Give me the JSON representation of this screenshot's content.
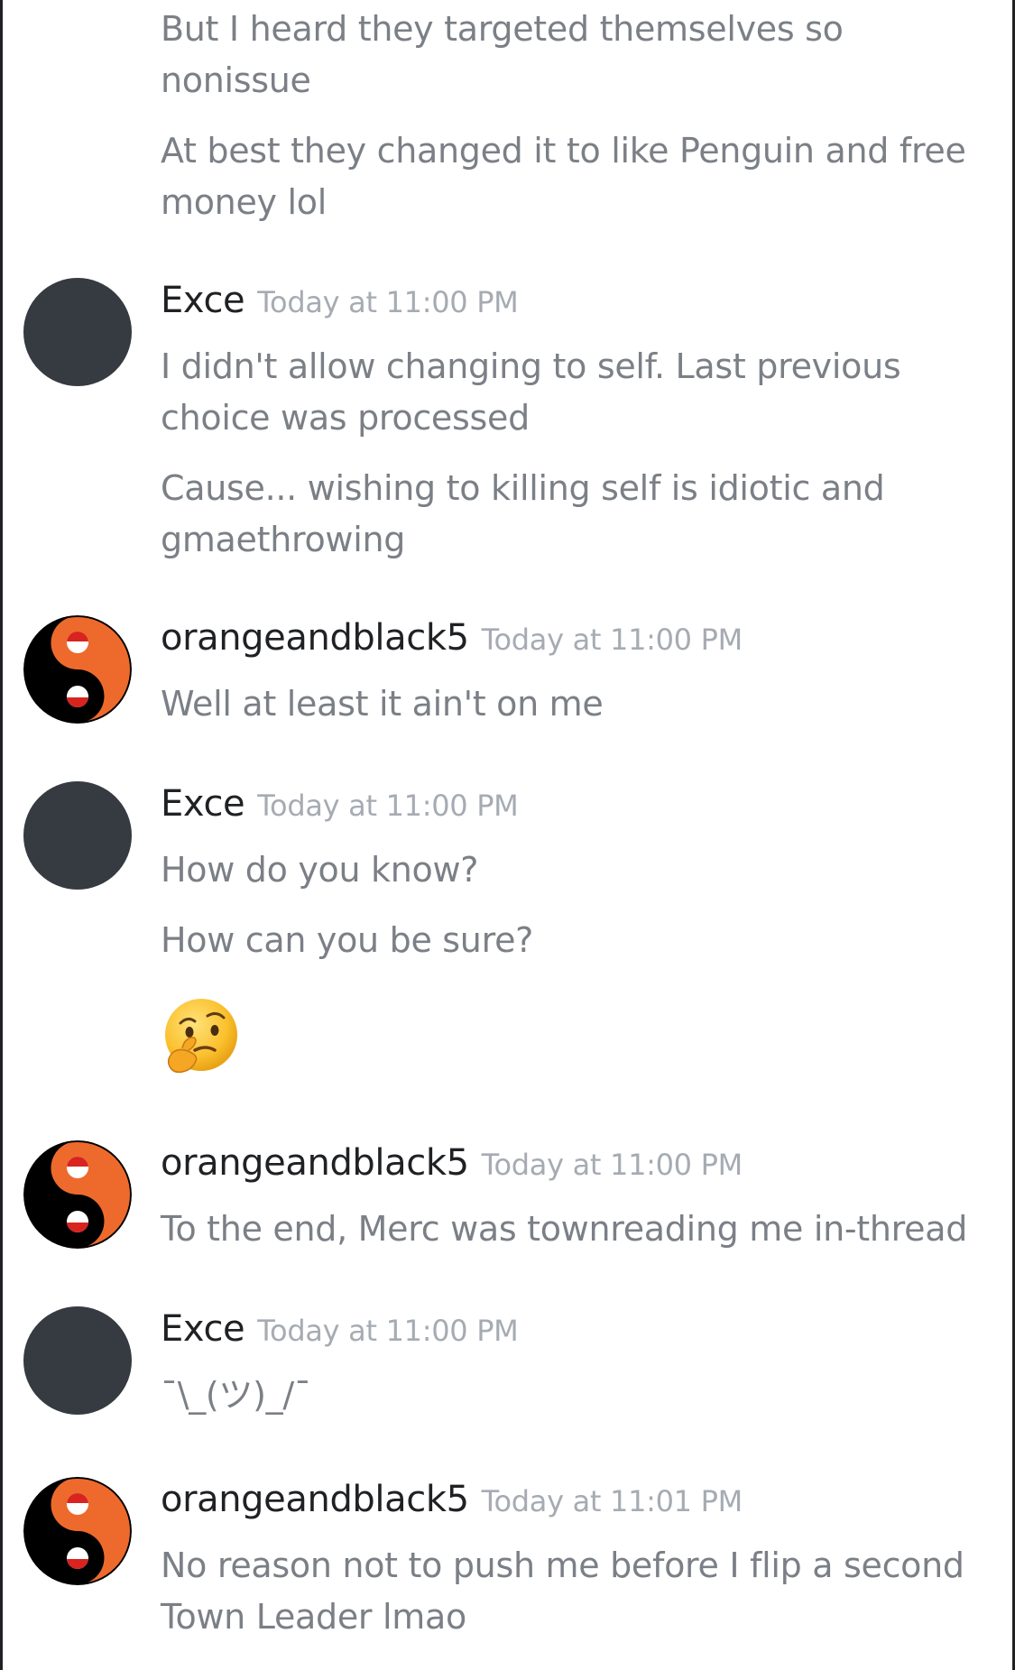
{
  "messages": [
    {
      "lines": [
        "But I heard they targeted themselves so",
        "nonissue",
        "At best they changed it to like Penguin and free",
        "money lol"
      ]
    },
    {
      "author": "Exce",
      "timestamp": "Today at 11:00 PM",
      "avatar": "dark-circle-avatar",
      "lines": [
        "I didn't allow changing to self. Last previous",
        "choice was processed",
        "Cause... wishing to killing self is idiotic and",
        "gmaethrowing"
      ]
    },
    {
      "author": "orangeandblack5",
      "timestamp": "Today at 11:00 PM",
      "avatar": "yin-yang-avatar",
      "lines": [
        "Well at least it ain't on me"
      ]
    },
    {
      "author": "Exce",
      "timestamp": "Today at 11:00 PM",
      "avatar": "dark-circle-avatar",
      "lines": [
        "How do you know?",
        "How can you be sure?"
      ],
      "emoji": "thinking-face-emoji"
    },
    {
      "author": "orangeandblack5",
      "timestamp": "Today at 11:00 PM",
      "avatar": "yin-yang-avatar",
      "lines": [
        "To the end, Merc was townreading me in-thread"
      ]
    },
    {
      "author": "Exce",
      "timestamp": "Today at 11:00 PM",
      "avatar": "dark-circle-avatar",
      "lines": [
        "¯\\_(ツ)_/¯"
      ]
    },
    {
      "author": "orangeandblack5",
      "timestamp": "Today at 11:01 PM",
      "avatar": "yin-yang-avatar",
      "lines": [
        "No reason not to push me before I flip a second",
        "Town Leader lmao"
      ]
    }
  ],
  "colors": {
    "username": "#1f2124",
    "message_text": "#7b7f86",
    "timestamp": "#a6abb3",
    "avatar_dark": "#363a41",
    "yin_yang_orange": "#ee6a2c",
    "yin_yang_black": "#000000"
  }
}
